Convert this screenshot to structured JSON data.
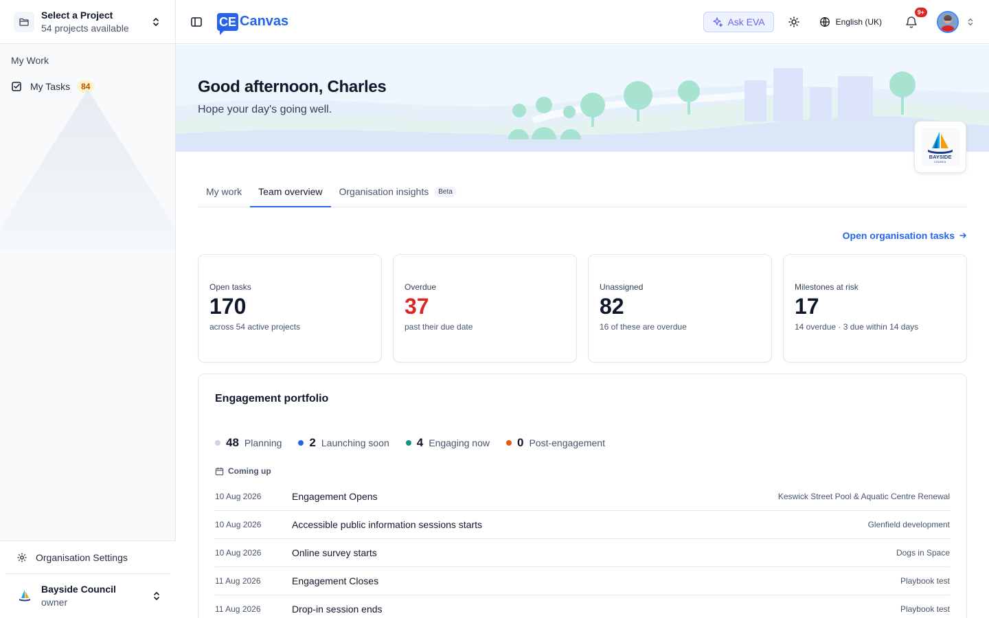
{
  "sidebar": {
    "project_select": {
      "title": "Select a Project",
      "subtitle": "54 projects available"
    },
    "section_label": "My Work",
    "items": [
      {
        "label": "My Tasks",
        "count": "84"
      }
    ],
    "bottom": {
      "org_settings_label": "Organisation Settings",
      "account_name": "Bayside Council",
      "account_role": "owner"
    }
  },
  "header": {
    "logo_mark": "CE",
    "logo_text": "Canvas",
    "ask_eva": "Ask EVA",
    "language": "English (UK)",
    "notifications_badge": "9+"
  },
  "hero": {
    "greeting": "Good afternoon, Charles",
    "subtitle": "Hope your day's going well.",
    "org_logo_text": "BAYSIDE",
    "org_logo_subtext": "COUNCIL"
  },
  "tabs": [
    {
      "label": "My work"
    },
    {
      "label": "Team overview",
      "active": true
    },
    {
      "label": "Organisation insights",
      "badge": "Beta"
    }
  ],
  "open_link": "Open organisation tasks",
  "stats": [
    {
      "label": "Open tasks",
      "value": "170",
      "sub": "across 54 active projects"
    },
    {
      "label": "Overdue",
      "value": "37",
      "sub": "past their due date",
      "color": "#dc2626"
    },
    {
      "label": "Unassigned",
      "value": "82",
      "sub": "16 of these are overdue"
    },
    {
      "label": "Milestones at risk",
      "value": "17",
      "sub": "14 overdue · 3 due within 14 days"
    }
  ],
  "portfolio": {
    "title": "Engagement portfolio",
    "stages": [
      {
        "count": "48",
        "label": "Planning",
        "color": "#cbd5e1"
      },
      {
        "count": "2",
        "label": "Launching soon",
        "color": "#2563eb"
      },
      {
        "count": "4",
        "label": "Engaging now",
        "color": "#0d9488"
      },
      {
        "count": "0",
        "label": "Post-engagement",
        "color": "#ea580c"
      }
    ],
    "coming_up_label": "Coming up",
    "events": [
      {
        "date": "10 Aug 2026",
        "title": "Engagement Opens",
        "project": "Keswick Street Pool & Aquatic Centre Renewal"
      },
      {
        "date": "10 Aug 2026",
        "title": "Accessible public information sessions starts",
        "project": "Glenfield development"
      },
      {
        "date": "10 Aug 2026",
        "title": "Online survey starts",
        "project": "Dogs in Space"
      },
      {
        "date": "11 Aug 2026",
        "title": "Engagement Closes",
        "project": "Playbook test"
      },
      {
        "date": "11 Aug 2026",
        "title": "Drop-in session ends",
        "project": "Playbook test"
      }
    ]
  }
}
